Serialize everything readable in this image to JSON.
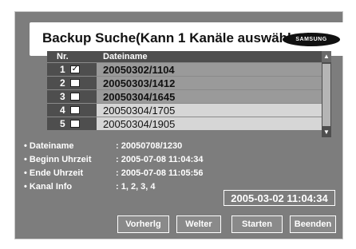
{
  "title": "Backup Suche(Kann 1 Kanäle auswählen)",
  "logo": "SAMSUNG",
  "table": {
    "headers": {
      "nr": "Nr.",
      "name": "Dateiname"
    },
    "rows": [
      {
        "num": "1",
        "checked": true,
        "check_glyph": "✓",
        "name": "20050302/1104",
        "selected": true
      },
      {
        "num": "2",
        "checked": false,
        "check_glyph": "",
        "name": "20050303/1412",
        "selected": true
      },
      {
        "num": "3",
        "checked": false,
        "check_glyph": "",
        "name": "20050304/1645",
        "selected": true
      },
      {
        "num": "4",
        "checked": false,
        "check_glyph": "",
        "name": "20050304/1705",
        "selected": false
      },
      {
        "num": "5",
        "checked": false,
        "check_glyph": "",
        "name": "20050304/1905",
        "selected": false
      }
    ],
    "scroll_up_glyph": "▲",
    "scroll_down_glyph": "▼"
  },
  "info": {
    "dateiname_label": "• Dateiname",
    "dateiname_value": ": 20050708/1230",
    "beginn_label": "• Beginn Uhrzeit",
    "beginn_value": ": 2005-07-08 11:04:34",
    "ende_label": "• Ende Uhrzeit",
    "ende_value": ": 2005-07-08 11:05:56",
    "kanal_label": "• Kanal Info",
    "kanal_value": ": 1, 2, 3, 4"
  },
  "clock": "2005-03-02  11:04:34",
  "buttons": {
    "prev": "Vorherlg",
    "next": "Welter",
    "start": "Starten",
    "end": "Beenden"
  }
}
